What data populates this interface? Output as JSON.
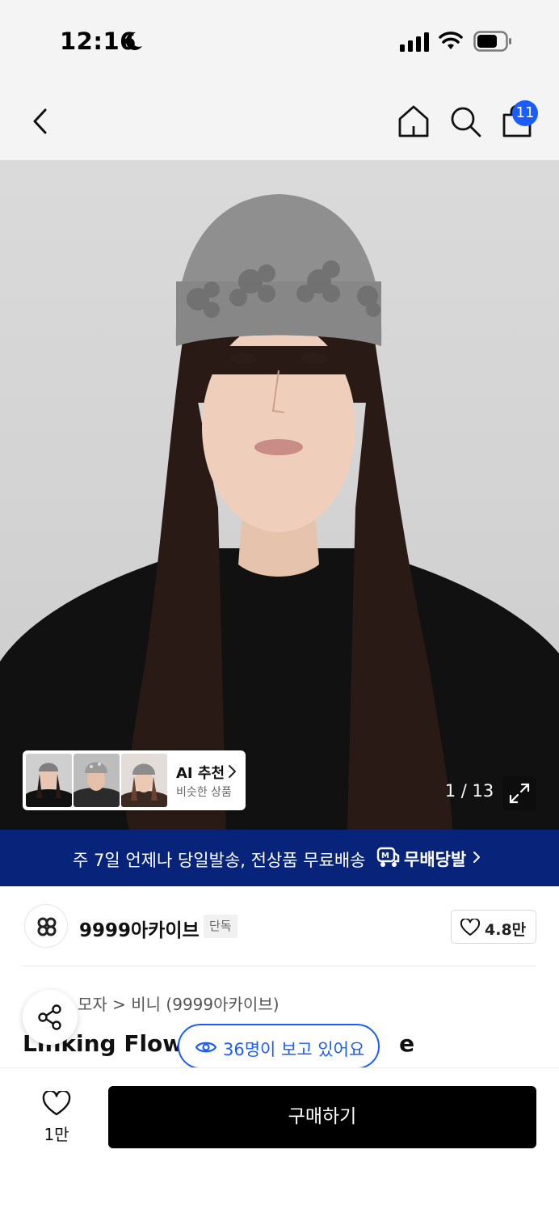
{
  "status_bar": {
    "time": "12:16"
  },
  "nav": {
    "cart_badge": "11"
  },
  "hero": {
    "page_counter": "1 / 13",
    "ai_recommend": {
      "title": "AI 추천",
      "subtitle": "비슷한 상품"
    }
  },
  "promo": {
    "text": "주 7일 언제나 당일발송, 전상품 무료배송",
    "brand": "무배당발"
  },
  "brand": {
    "name": "9999아카이브",
    "tag": "단독",
    "likes": "4.8만"
  },
  "breadcrumb": {
    "text": "모자 > 비니 (9999아카이브)"
  },
  "product": {
    "title": "Linking Flowe",
    "title_tail": "e"
  },
  "viewers": {
    "text": "36명이 보고 있어요"
  },
  "bottom": {
    "fav_count": "1만",
    "buy_label": "구매하기"
  },
  "colors": {
    "accent": "#1a5cff",
    "promo_bg": "#08237a",
    "buy_bg": "#000000"
  }
}
